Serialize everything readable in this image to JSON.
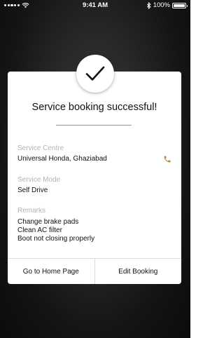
{
  "status_bar": {
    "time": "9:41 AM",
    "battery_percent_label": "100%",
    "battery_level": 1.0,
    "signal_icon": "signal-dots-icon",
    "wifi_icon": "wifi-icon",
    "bluetooth_icon": "bluetooth-icon"
  },
  "dialog": {
    "icon": "checkmark-icon",
    "title": "Service booking successful!",
    "fields": [
      {
        "label": "Service Centre",
        "value": "Universal Honda, Ghaziabad"
      },
      {
        "label": "Service Mode",
        "value": "Self Drive"
      },
      {
        "label": "Remarks",
        "lines": [
          "Change brake pads",
          "Clean AC filter",
          "Boot not closing properly"
        ]
      }
    ],
    "phone_icon": "phone-icon",
    "accent_color": "#b08a3c",
    "actions": {
      "home_label": "Go to Home Page",
      "edit_label": "Edit Booking"
    }
  }
}
